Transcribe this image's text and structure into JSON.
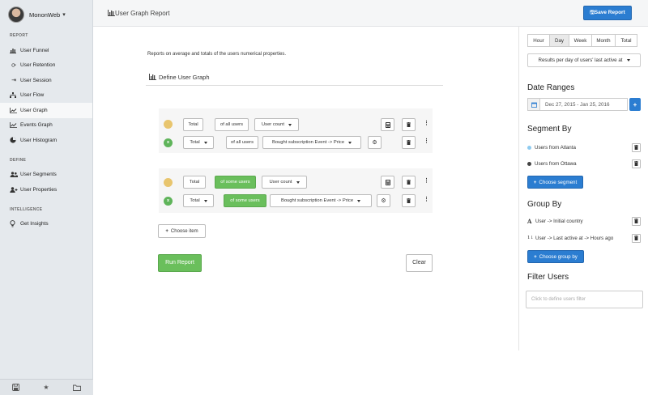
{
  "app": {
    "profile_name": "MononWeb",
    "page_title": "User Graph Report",
    "save_label": "Save Report"
  },
  "sidebar": {
    "sections": [
      {
        "title": "REPORT",
        "items": [
          {
            "label": "User Funnel",
            "icon": "bar-chart-icon"
          },
          {
            "label": "User Retention",
            "icon": "refresh-icon"
          },
          {
            "label": "User Session",
            "icon": "sign-in-icon"
          },
          {
            "label": "User Flow",
            "icon": "sitemap-icon"
          },
          {
            "label": "User Graph",
            "icon": "line-chart-icon",
            "active": true
          },
          {
            "label": "Events Graph",
            "icon": "line-chart-icon"
          },
          {
            "label": "User Histogram",
            "icon": "pie-chart-icon"
          }
        ]
      },
      {
        "title": "DEFINE",
        "items": [
          {
            "label": "User Segments",
            "icon": "users-icon"
          },
          {
            "label": "User Properties",
            "icon": "user-plus-icon"
          }
        ]
      },
      {
        "title": "INTELLIGENCE",
        "items": [
          {
            "label": "Get Insights",
            "icon": "lightbulb-icon"
          }
        ]
      }
    ]
  },
  "main": {
    "description": "Reports on average and totals of the users numerical properties.",
    "define_title": "Define User Graph",
    "groups": [
      {
        "row1": {
          "agg": "Total",
          "scope": "of all users",
          "metric": "User count"
        },
        "row2": {
          "agg": "Total",
          "scope": "of all users",
          "metric": "Bought subscription Event -> Price"
        }
      },
      {
        "row1": {
          "agg": "Total",
          "scope": "of some users",
          "metric": "User count"
        },
        "row2": {
          "agg": "Total",
          "scope": "of some users",
          "metric": "Bought subscription Event -> Price"
        }
      }
    ],
    "choose_item": "Choose item",
    "run_label": "Run Report",
    "clear_label": "Clear"
  },
  "right": {
    "periods": [
      "Hour",
      "Day",
      "Week",
      "Month",
      "Total"
    ],
    "active_period": "Day",
    "results_select": "Results per day of users' last active at",
    "date_ranges_title": "Date Ranges",
    "date_range": "Dec 27, 2015 - Jan 25, 2016",
    "segment_by_title": "Segment By",
    "segments": [
      {
        "label": "Users from Atlanta",
        "color": "#8ecbf0"
      },
      {
        "label": "Users from Ottawa",
        "color": "#444444"
      }
    ],
    "choose_segment": "Choose segment",
    "group_by_title": "Group By",
    "group_items": [
      {
        "label": "User -> Initial country",
        "icon": "alpha-icon"
      },
      {
        "label": "User -> Last active at -> Hours ago",
        "icon": "numeric-sort-icon"
      }
    ],
    "choose_group": "Choose group by",
    "filter_title": "Filter Users",
    "filter_placeholder": "Click to define users filter"
  },
  "colors": {
    "primary": "#2b7dd1",
    "success": "#6abf5c",
    "dot_yellow": "#e8c56e",
    "sidebar_bg": "#e5e9ed"
  }
}
